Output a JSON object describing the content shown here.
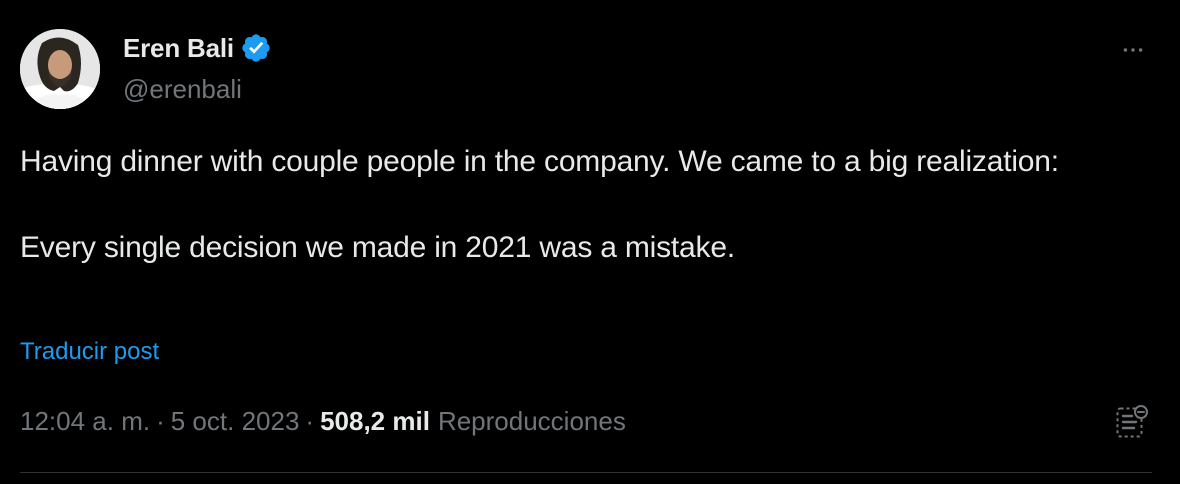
{
  "author": {
    "name": "Eren Bali",
    "handle": "@erenbali",
    "verified": true,
    "avatar_icon": "person-photo-avatar"
  },
  "tweet": {
    "lines": [
      "Having dinner with couple people in the company. We came to a big realization:",
      "Every single decision we made in 2021 was a mistake."
    ],
    "translate_label": "Traducir post"
  },
  "meta": {
    "time": "12:04 a. m.",
    "separator": "·",
    "date": "5 oct. 2023",
    "views_count": "508,2 mil",
    "views_label": "Reproducciones"
  },
  "icons": {
    "more": "more-horizontal-icon",
    "analytics": "post-analytics-icon",
    "verified": "verified-badge-icon"
  },
  "colors": {
    "background": "#000000",
    "text_primary": "#e7e9ea",
    "text_secondary": "#71767b",
    "accent": "#1d9bf0",
    "divider": "#2f3336"
  }
}
